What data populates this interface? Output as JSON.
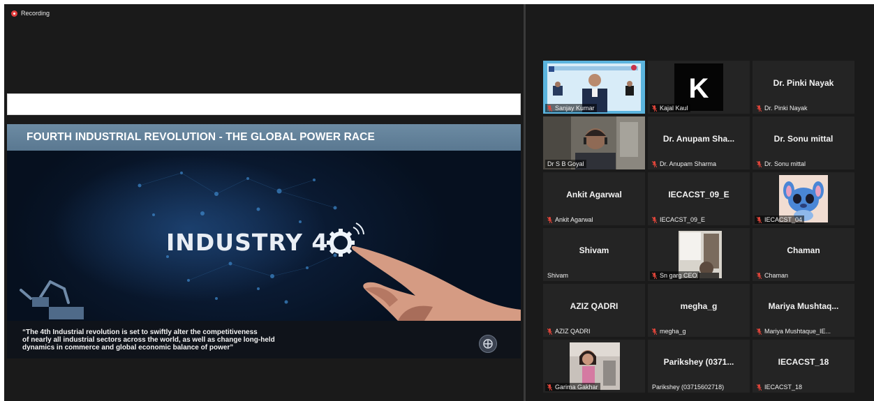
{
  "recording_label": "Recording",
  "slide": {
    "title": "FOURTH INDUSTRIAL REVOLUTION - THE GLOBAL POWER RACE",
    "center_text": "INDUSTRY 4.",
    "quote_lines": [
      "“The 4th Industrial revolution is set to swiftly alter the competitiveness",
      "of nearly all industrial sectors across the world, as well as change long-held",
      "dynamics in commerce and global economic balance of power”"
    ]
  },
  "participants": [
    {
      "name": "Sanjay Kumar",
      "big": "",
      "muted": true,
      "video": "conference"
    },
    {
      "name": "Kajal Kaul",
      "big": "",
      "muted": true,
      "video": "letter-k"
    },
    {
      "name": "Dr. Pinki Nayak",
      "big": "Dr. Pinki Nayak",
      "muted": true,
      "video": ""
    },
    {
      "name": "Dr S B Goyal",
      "big": "",
      "muted": false,
      "video": "person",
      "active": true
    },
    {
      "name": "Dr. Anupam Sharma",
      "big": "Dr. Anupam Sha...",
      "muted": true,
      "video": ""
    },
    {
      "name": "Dr. Sonu mittal",
      "big": "Dr. Sonu mittal",
      "muted": true,
      "video": ""
    },
    {
      "name": "Ankit Agarwal",
      "big": "Ankit Agarwal",
      "muted": true,
      "video": ""
    },
    {
      "name": "IECACST_09_E",
      "big": "IECACST_09_E",
      "muted": true,
      "video": ""
    },
    {
      "name": "IECACST_04",
      "big": "",
      "muted": true,
      "video": "cartoon"
    },
    {
      "name": "Shivam",
      "big": "Shivam",
      "muted": false,
      "video": ""
    },
    {
      "name": "Sn garg CEO",
      "big": "",
      "muted": true,
      "video": "room"
    },
    {
      "name": "Chaman",
      "big": "Chaman",
      "muted": true,
      "video": ""
    },
    {
      "name": "AZIZ QADRI",
      "big": "AZIZ QADRI",
      "muted": true,
      "video": ""
    },
    {
      "name": "megha_g",
      "big": "megha_g",
      "muted": true,
      "video": ""
    },
    {
      "name": "Mariya Mushtaque_IE...",
      "big": "Mariya  Mushtaq...",
      "muted": true,
      "video": ""
    },
    {
      "name": "Garima Gakhar",
      "big": "",
      "muted": true,
      "video": "girl"
    },
    {
      "name": "Parikshey (03715602718)",
      "big": "Parikshey  (0371...",
      "muted": false,
      "video": ""
    },
    {
      "name": "IECACST_18",
      "big": "IECACST_18",
      "muted": true,
      "video": ""
    }
  ],
  "colors": {
    "background": "#1a1a1a",
    "tile": "#242424",
    "active_outline": "#c9e45b",
    "muted_icon": "#e0453a",
    "slide_title_band": "#5f7d95"
  },
  "icons": [
    "recording-dot-icon",
    "muted-mic-icon",
    "industry-gear-icon",
    "robot-arm-icon",
    "logo-icon"
  ]
}
